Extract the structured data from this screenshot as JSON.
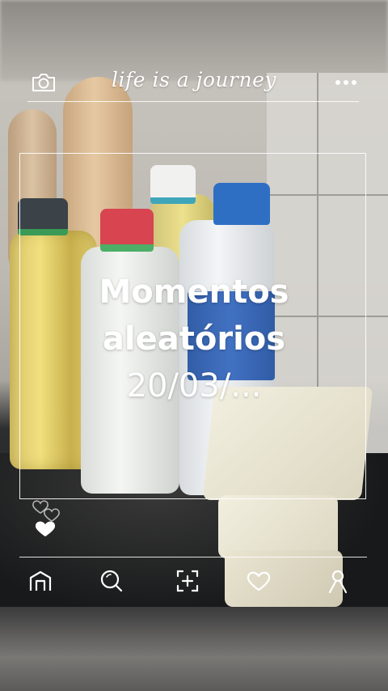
{
  "header": {
    "tagline": "life is a journey",
    "left_icon": "camera-icon",
    "right_icon": "more-icon"
  },
  "post": {
    "title_line1": "Momentos",
    "title_line2": "aleatórios",
    "title_line3": "20/03/..."
  },
  "reactions": {
    "icons": [
      "heart-outline-icon",
      "heart-outline-icon",
      "heart-filled-icon"
    ]
  },
  "bottom_nav": {
    "items": [
      {
        "icon": "home-icon"
      },
      {
        "icon": "search-icon"
      },
      {
        "icon": "add-post-icon"
      },
      {
        "icon": "heart-icon"
      },
      {
        "icon": "profile-icon"
      }
    ]
  },
  "colors": {
    "overlay_line": "#ffffff",
    "text": "#ffffff"
  }
}
